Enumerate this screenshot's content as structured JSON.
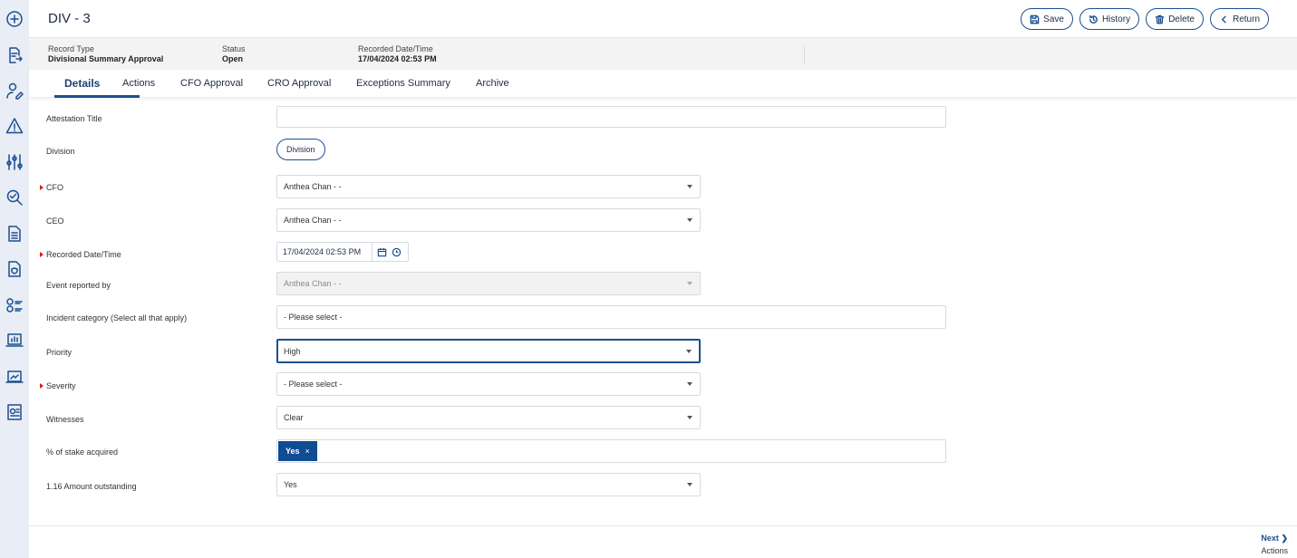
{
  "sidebar": {
    "items": [
      {
        "icon": "add-circle-icon"
      },
      {
        "icon": "document-export-icon"
      },
      {
        "icon": "user-edit-icon"
      },
      {
        "icon": "warning-icon"
      },
      {
        "icon": "sliders-icon"
      },
      {
        "icon": "search-check-icon"
      },
      {
        "icon": "document-icon"
      },
      {
        "icon": "document-shield-icon"
      },
      {
        "icon": "checklist-icon"
      },
      {
        "icon": "dashboard-icon"
      },
      {
        "icon": "chart-trend-icon"
      },
      {
        "icon": "report-icon"
      }
    ]
  },
  "header": {
    "title": "DIV - 3",
    "buttons": {
      "save": "Save",
      "history": "History",
      "delete": "Delete",
      "return": "Return"
    }
  },
  "info": {
    "record_type_label": "Record Type",
    "record_type_value": "Divisional Summary Approval",
    "status_label": "Status",
    "status_value": "Open",
    "recorded_label": "Recorded Date/Time",
    "recorded_value": "17/04/2024 02:53 PM"
  },
  "tabs": [
    {
      "label": "Details",
      "active": true
    },
    {
      "label": "Actions"
    },
    {
      "label": "CFO Approval"
    },
    {
      "label": "CRO Approval"
    },
    {
      "label": "Exceptions Summary"
    },
    {
      "label": "Archive"
    }
  ],
  "form": {
    "attestation_title": {
      "label": "Attestation Title",
      "value": ""
    },
    "division": {
      "label": "Division",
      "button": "Division"
    },
    "cfo": {
      "label": "CFO",
      "value": "Anthea Chan - -",
      "required": true
    },
    "ceo": {
      "label": "CEO",
      "value": "Anthea Chan - -"
    },
    "recorded": {
      "label": "Recorded Date/Time",
      "value": "17/04/2024 02:53 PM",
      "required": true
    },
    "event_reported_by": {
      "label": "Event reported by",
      "value": "Anthea Chan - -",
      "disabled": true
    },
    "incident_category": {
      "label": "Incident category (Select all that apply)",
      "placeholder": "- Please select -"
    },
    "priority": {
      "label": "Priority",
      "value": "High"
    },
    "severity": {
      "label": "Severity",
      "value": "- Please select -",
      "required": true
    },
    "witnesses": {
      "label": "Witnesses",
      "value": "Clear"
    },
    "stake": {
      "label": "% of stake acquired",
      "tag": "Yes",
      "tag_remove": "×"
    },
    "amount_outstanding": {
      "label": "1.16 Amount outstanding",
      "value": "Yes"
    }
  },
  "footer": {
    "next_label": "Next",
    "next_sub": "Actions"
  },
  "colors": {
    "primary": "#1c4f91",
    "required": "#d42020",
    "sidebar_bg": "#e9edf5",
    "tag_bg": "#0f4c91"
  }
}
